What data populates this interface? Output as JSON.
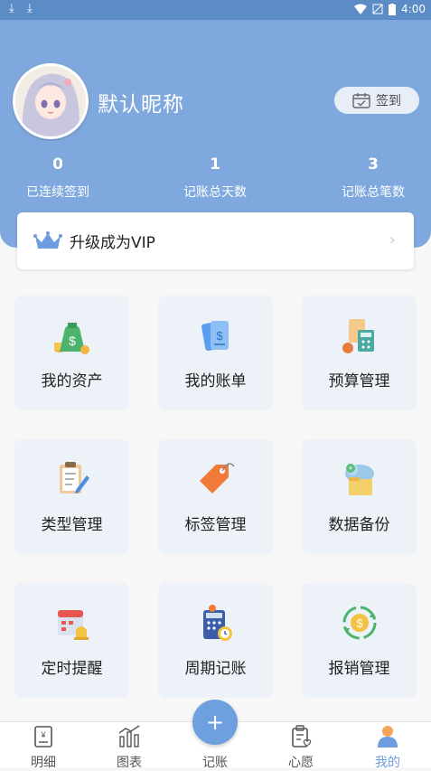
{
  "status_bar": {
    "time": "4:00",
    "download_icons": [
      "download-icon",
      "download-icon"
    ]
  },
  "profile": {
    "nickname": "默认昵称",
    "signin_label": "签到"
  },
  "stats": [
    {
      "value": "0",
      "label": "已连续签到"
    },
    {
      "value": "1",
      "label": "记账总天数"
    },
    {
      "value": "3",
      "label": "记账总笔数"
    }
  ],
  "vip": {
    "label": "升级成为VIP"
  },
  "features": [
    {
      "label": "我的资产",
      "icon": "money-bag-icon"
    },
    {
      "label": "我的账单",
      "icon": "bill-icon"
    },
    {
      "label": "预算管理",
      "icon": "budget-icon"
    },
    {
      "label": "类型管理",
      "icon": "clipboard-icon"
    },
    {
      "label": "标签管理",
      "icon": "tag-icon"
    },
    {
      "label": "数据备份",
      "icon": "cloud-backup-icon"
    },
    {
      "label": "定时提醒",
      "icon": "calendar-bell-icon"
    },
    {
      "label": "周期记账",
      "icon": "calculator-clock-icon"
    },
    {
      "label": "报销管理",
      "icon": "reimburse-icon"
    }
  ],
  "tabbar": {
    "items": [
      {
        "label": "明细",
        "icon": "detail-icon"
      },
      {
        "label": "图表",
        "icon": "chart-icon"
      },
      {
        "label": "记账",
        "icon": "plus-icon"
      },
      {
        "label": "心愿",
        "icon": "wish-icon"
      },
      {
        "label": "我的",
        "icon": "profile-icon"
      }
    ],
    "active": "我的",
    "fab_symbol": "+"
  },
  "colors": {
    "header": "#7fa9de",
    "accent": "#6ea0e0",
    "card": "#edf1f8"
  }
}
